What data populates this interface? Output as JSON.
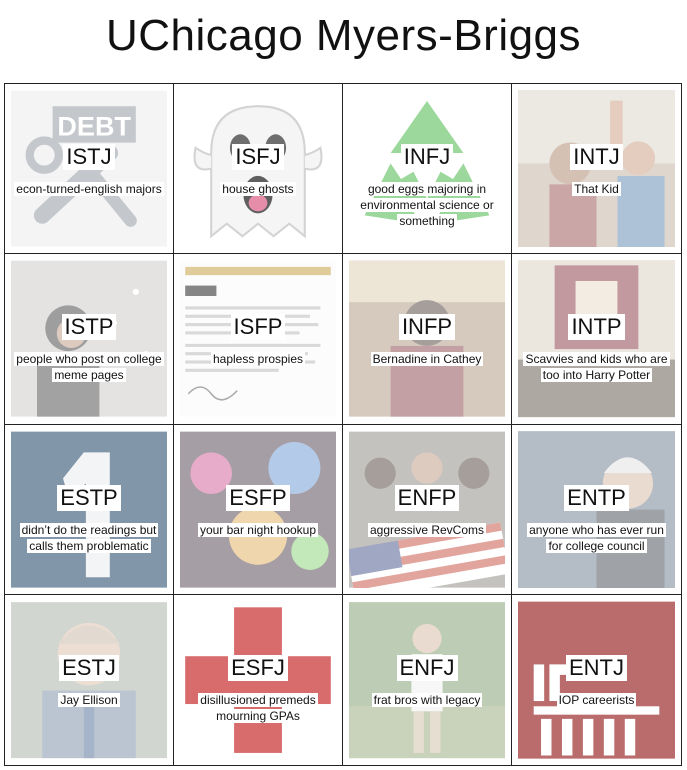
{
  "title": "UChicago Myers-Briggs",
  "cells": [
    {
      "type": "ISTJ",
      "desc": "econ-turned-english majors",
      "icon": "debt-wrench-icon"
    },
    {
      "type": "ISFJ",
      "desc": "house ghosts",
      "icon": "ghost-icon"
    },
    {
      "type": "INFJ",
      "desc": "good eggs majoring in environmental science or something",
      "icon": "recycle-icon"
    },
    {
      "type": "INTJ",
      "desc": "That Kid",
      "icon": "classroom-photo"
    },
    {
      "type": "ISTP",
      "desc": "people who post on college meme pages",
      "icon": "snowy-portrait-photo"
    },
    {
      "type": "ISFP",
      "desc": "hapless prospies",
      "icon": "admission-letter-image"
    },
    {
      "type": "INFP",
      "desc": "Bernadine in Cathey",
      "icon": "cafeteria-photo"
    },
    {
      "type": "INTP",
      "desc": "Scavvies and kids who are too into Harry Potter",
      "icon": "crest-banner-photo"
    },
    {
      "type": "ESTP",
      "desc": "didn’t do the readings but calls them problematic",
      "icon": "number-one-icon"
    },
    {
      "type": "ESFP",
      "desc": "your bar night hookup",
      "icon": "party-lights-photo"
    },
    {
      "type": "ENFP",
      "desc": "aggressive RevComs",
      "icon": "protest-flag-photo"
    },
    {
      "type": "ENTP",
      "desc": "anyone who has ever run for college council",
      "icon": "politician-photo"
    },
    {
      "type": "ESTJ",
      "desc": "Jay Ellison",
      "icon": "portrait-photo"
    },
    {
      "type": "ESFJ",
      "desc": "disillusioned premeds mourning GPAs",
      "icon": "medical-cross-icon"
    },
    {
      "type": "ENFJ",
      "desc": "frat bros with legacy",
      "icon": "outdoor-person-photo"
    },
    {
      "type": "ENTJ",
      "desc": "IOP careerists",
      "icon": "iop-logo-icon"
    }
  ],
  "colors": {
    "debt_grey": "#9aa1a8",
    "recycle_green": "#5bbf5a",
    "cross_red": "#cc3b3b",
    "iop_maroon": "#a33a3a",
    "slate_blue": "#4e6a86"
  }
}
